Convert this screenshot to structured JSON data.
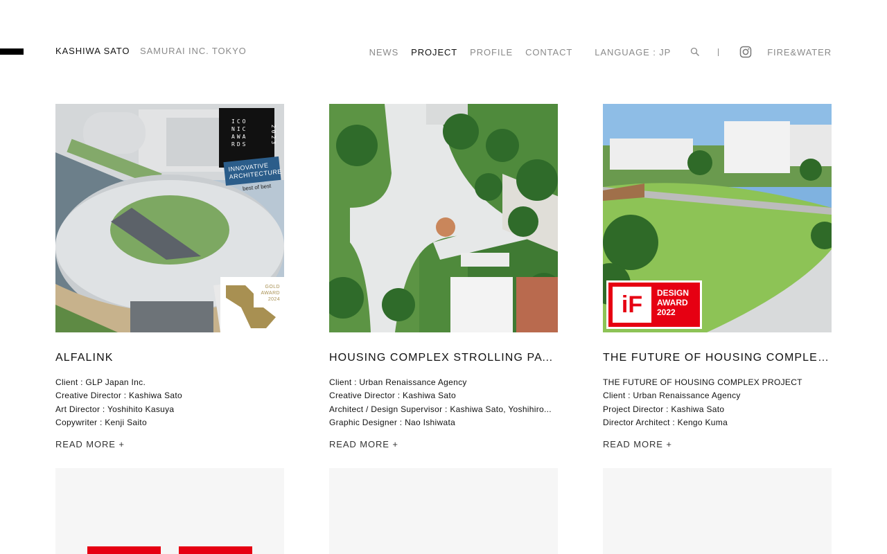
{
  "header": {
    "brand": "KASHIWA SATO",
    "company": "SAMURAI INC. TOKYO",
    "nav": [
      "NEWS",
      "PROJECT",
      "PROFILE",
      "CONTACT"
    ],
    "active_nav": "PROJECT",
    "language": "LANGUAGE : JP",
    "link": "FIRE&WATER",
    "icons": [
      "search-icon",
      "instagram-icon",
      "menu-icon"
    ]
  },
  "projects": [
    {
      "title": "ALFALINK",
      "credits": [
        "Client : GLP Japan Inc.",
        "Creative Director : Kashiwa Sato",
        "Art Director : Yoshihito Kasuya",
        "Copywriter : Kenji Saito"
      ],
      "read_more": "READ MORE +",
      "badges": {
        "iconic_lines": [
          "ICO",
          "NIC",
          "AWA",
          "RDS"
        ],
        "iconic_year": "2023",
        "banner": "INNOVATIVE ARCHITECTURE",
        "best": "best of best",
        "gold": [
          "GOLD",
          "AWARD",
          "2024"
        ]
      }
    },
    {
      "title": "HOUSING COMPLEX STROLLING PATH",
      "credits": [
        "Client : Urban Renaissance Agency",
        "Creative Director : Kashiwa Sato",
        "Architect / Design Supervisor : Kashiwa Sato, Yoshihiro...",
        "Graphic Designer : Nao Ishiwata"
      ],
      "read_more": "READ MORE +"
    },
    {
      "title": "THE FUTURE OF HOUSING COMPLEX ...",
      "credits": [
        "THE FUTURE OF HOUSING COMPLEX PROJECT",
        "Client : Urban Renaissance Agency",
        "Project Director : Kashiwa Sato",
        "Director Architect : Kengo Kuma"
      ],
      "read_more": "READ MORE +",
      "badges": {
        "if_logo": "iF",
        "if_lines": [
          "DESIGN",
          "AWARD",
          "2022"
        ]
      }
    }
  ],
  "colors": {
    "accent_red": "#e60012",
    "gold": "#a89052",
    "navy_banner": "#2b5d8a"
  }
}
